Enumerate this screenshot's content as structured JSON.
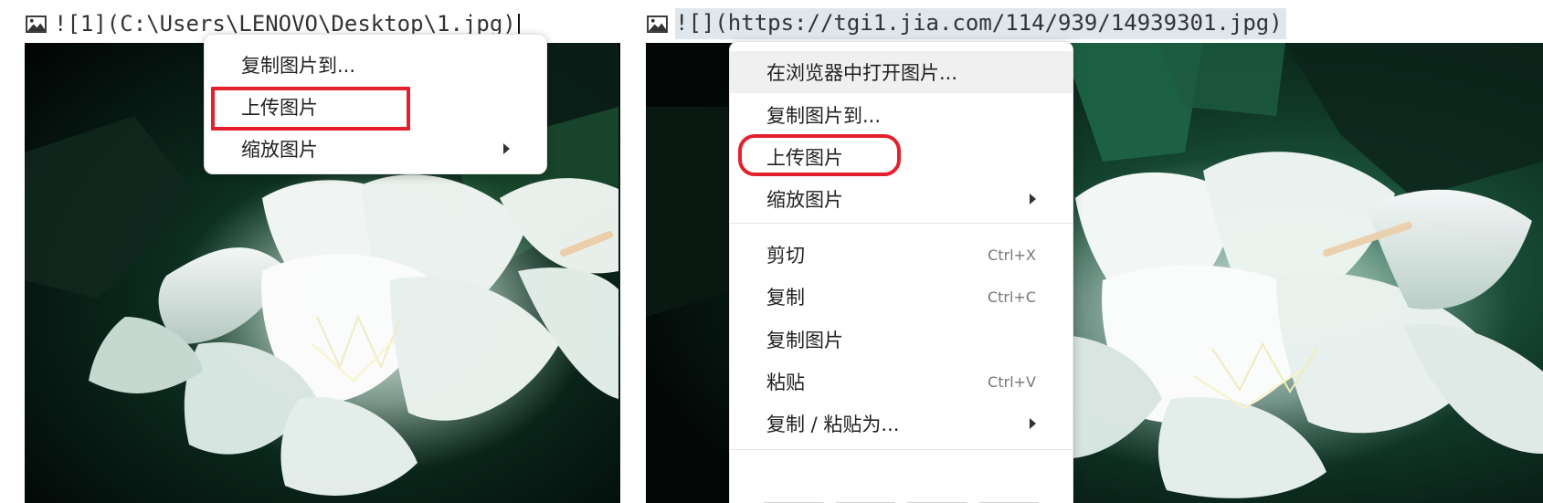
{
  "left": {
    "source_text": "![1](C:\\Users\\LENOVO\\Desktop\\1.jpg)",
    "menu": {
      "items": [
        {
          "label": "复制图片到..."
        },
        {
          "label": "上传图片"
        },
        {
          "label": "缩放图片",
          "arrow": "submenu-arrow-icon"
        }
      ]
    }
  },
  "right": {
    "source_text": "![](https://tgi1.jia.com/114/939/14939301.jpg)",
    "menu": {
      "items": [
        {
          "label": "在浏览器中打开图片..."
        },
        {
          "label": "复制图片到..."
        },
        {
          "label": "上传图片"
        },
        {
          "label": "缩放图片",
          "arrow": "submenu-arrow-icon"
        },
        {
          "label": "剪切",
          "shortcut": "Ctrl+X"
        },
        {
          "label": "复制",
          "shortcut": "Ctrl+C"
        },
        {
          "label": "复制图片"
        },
        {
          "label": "粘贴",
          "shortcut": "Ctrl+V"
        },
        {
          "label": "复制 / 粘贴为...",
          "arrow": "submenu-arrow-icon"
        }
      ]
    }
  },
  "icons": {
    "image_markdown": "image-icon"
  },
  "colors": {
    "annotation_red": "#e4202d",
    "hover_background": "#f0f0f0",
    "url_highlight": "#dfe6ec"
  }
}
